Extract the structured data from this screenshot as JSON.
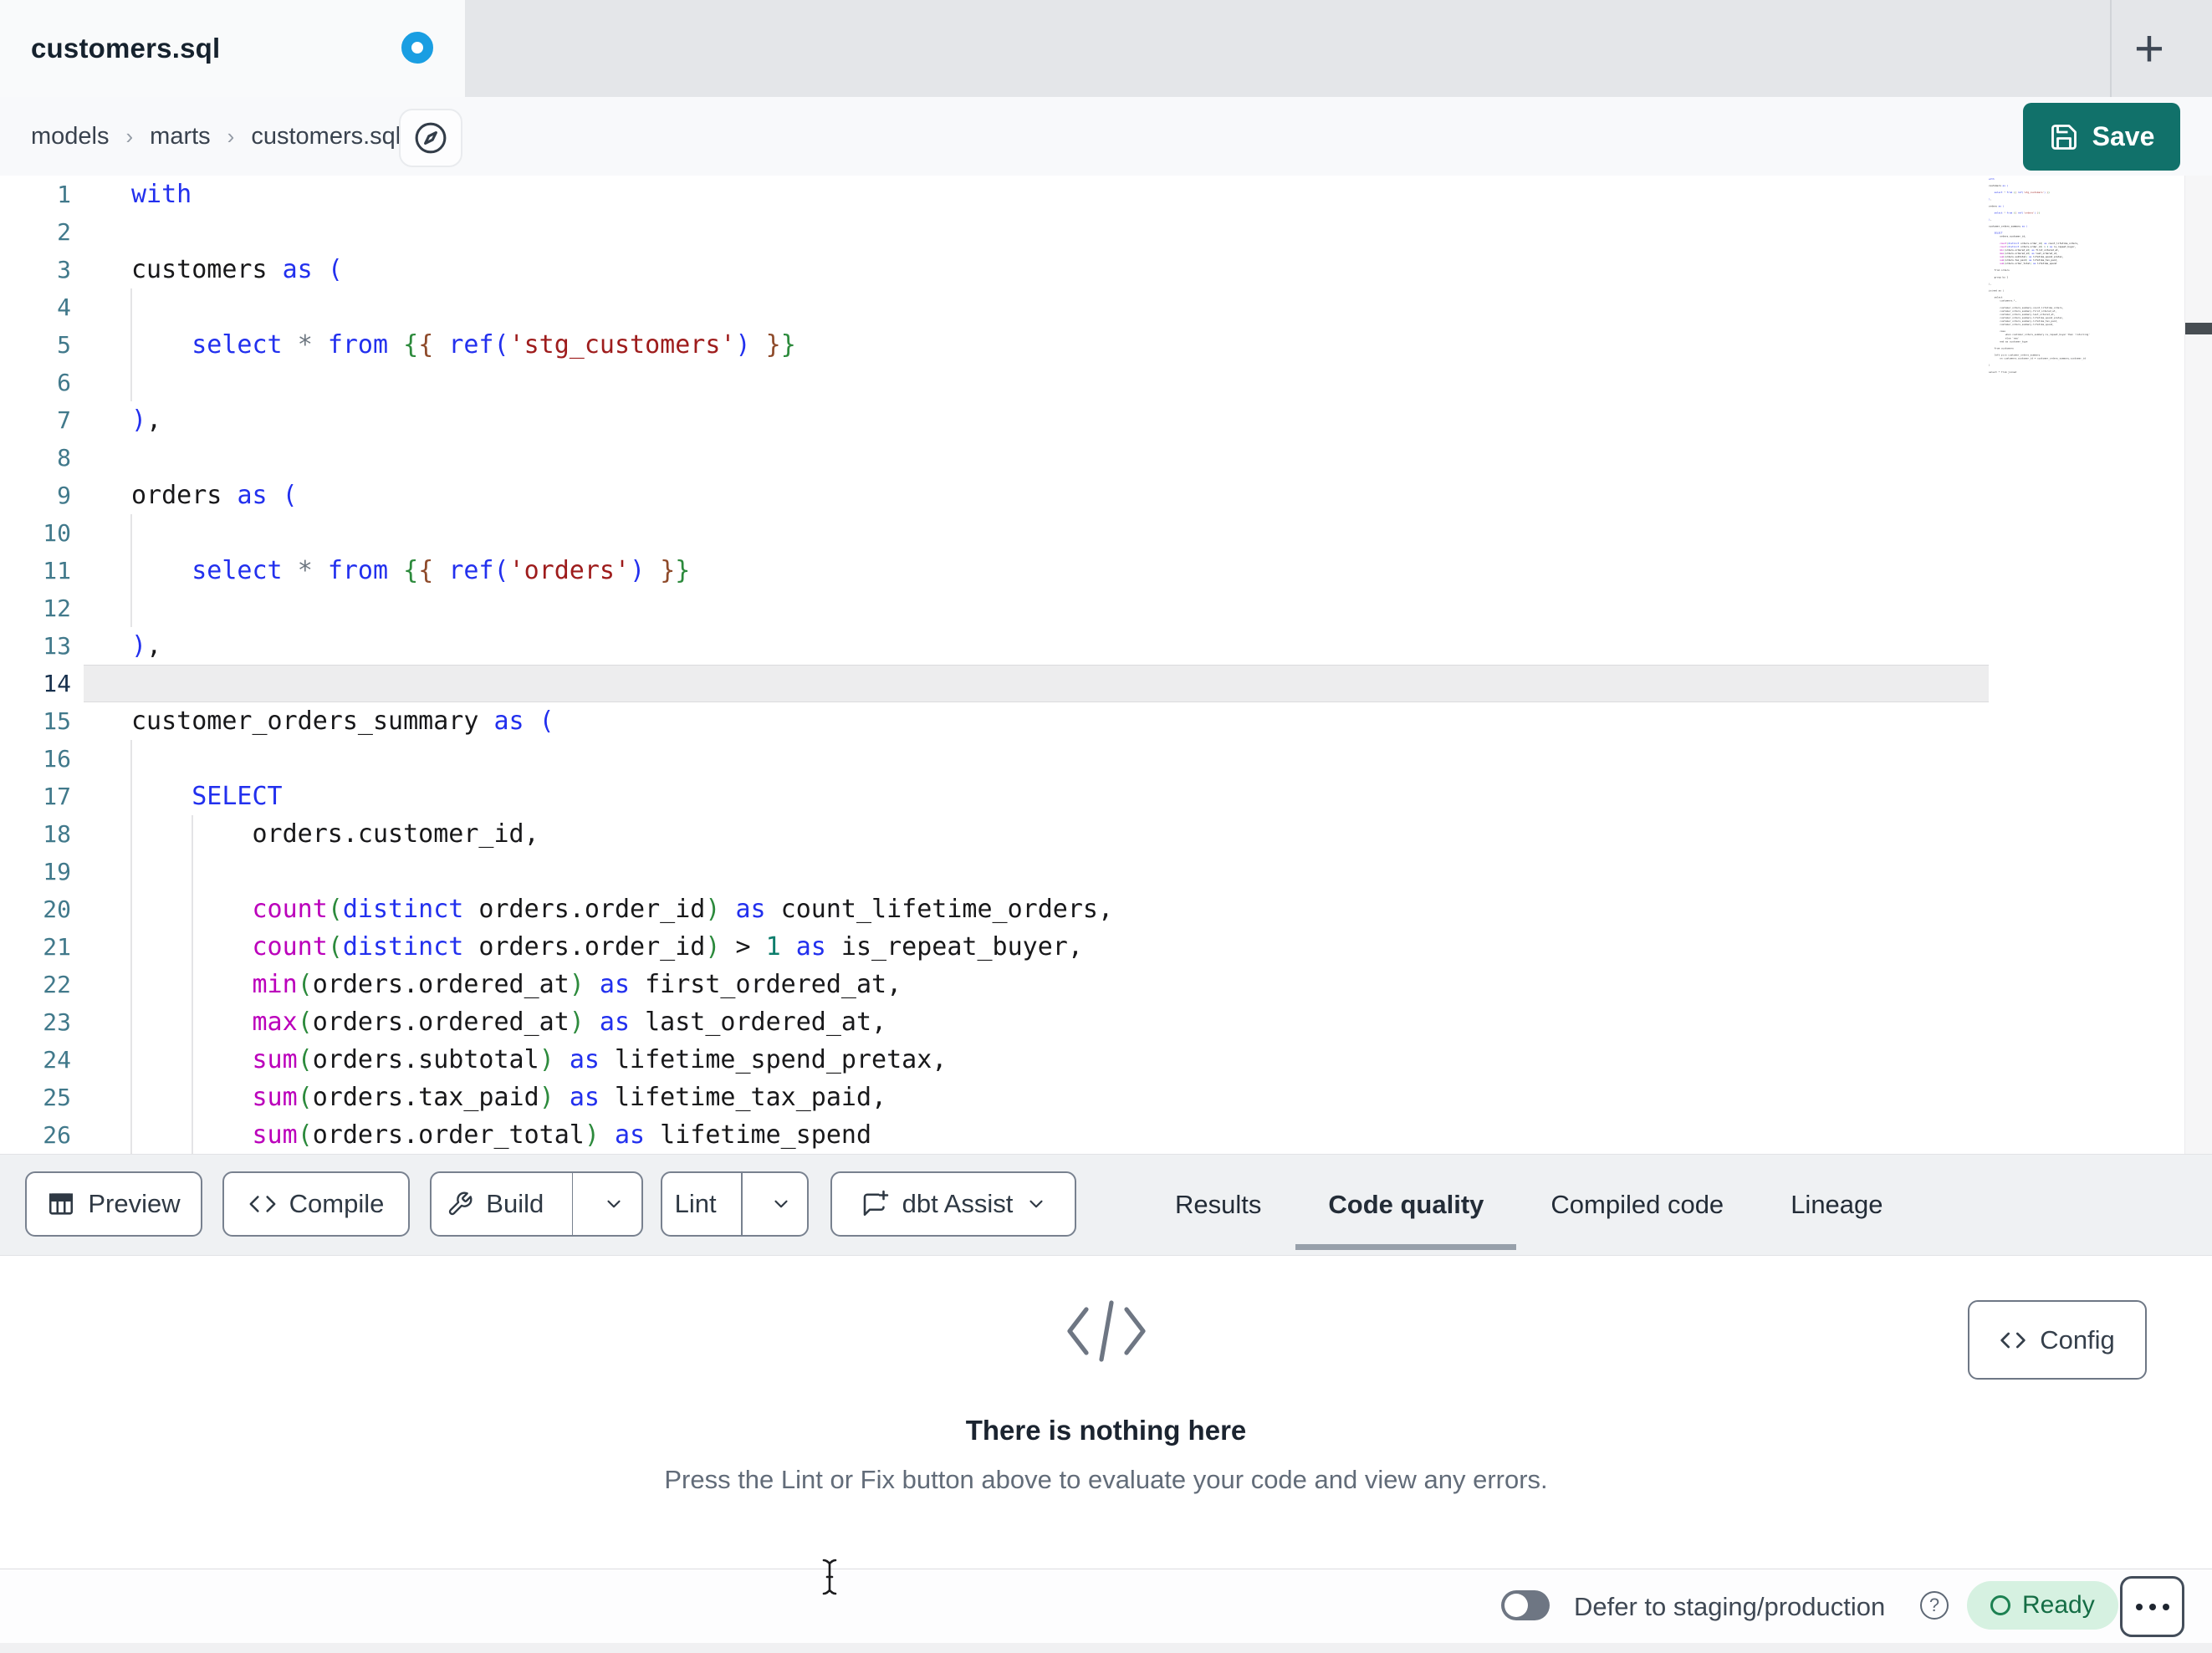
{
  "window": {
    "tab_title": "customers.sql",
    "new_tab_label": "+"
  },
  "breadcrumb": {
    "items": [
      "models",
      "marts",
      "customers.sql"
    ],
    "separator": "›"
  },
  "topbar": {
    "save_label": "Save"
  },
  "colors": {
    "save_teal": "#11716a",
    "unsaved_dot_blue": "#1a9ee2",
    "ready_green_bg": "#d6f1e1",
    "ready_green_text": "#156d45",
    "active_tab_underline": "#97a0aa",
    "keyword_blue": "#2230ee",
    "string_red": "#9e1c1c",
    "function_magenta": "#bb00bb"
  },
  "editor": {
    "active_line": 14,
    "lines": [
      {
        "n": 1,
        "tokens": [
          [
            "with",
            "kw"
          ]
        ]
      },
      {
        "n": 2,
        "tokens": []
      },
      {
        "n": 3,
        "tokens": [
          [
            "customers ",
            "tx"
          ],
          [
            "as",
            "kw"
          ],
          [
            " ",
            "tx"
          ],
          [
            "(",
            "kw"
          ]
        ]
      },
      {
        "n": 4,
        "tokens": []
      },
      {
        "n": 5,
        "tokens": [
          [
            "    ",
            "tx"
          ],
          [
            "select",
            "kw"
          ],
          [
            " ",
            "tx"
          ],
          [
            "*",
            "op"
          ],
          [
            " ",
            "tx"
          ],
          [
            "from",
            "kw"
          ],
          [
            " ",
            "tx"
          ],
          [
            "{",
            "grn"
          ],
          [
            "{",
            "brn"
          ],
          [
            " ",
            "tx"
          ],
          [
            "ref",
            "kw"
          ],
          [
            "(",
            "kw"
          ],
          [
            "'stg_customers'",
            "str"
          ],
          [
            ")",
            "kw"
          ],
          [
            " ",
            "tx"
          ],
          [
            "}",
            "brn"
          ],
          [
            "}",
            "grn"
          ]
        ]
      },
      {
        "n": 6,
        "tokens": []
      },
      {
        "n": 7,
        "tokens": [
          [
            ")",
            "kw"
          ],
          [
            ",",
            "tx"
          ]
        ]
      },
      {
        "n": 8,
        "tokens": []
      },
      {
        "n": 9,
        "tokens": [
          [
            "orders ",
            "tx"
          ],
          [
            "as",
            "kw"
          ],
          [
            " ",
            "tx"
          ],
          [
            "(",
            "kw"
          ]
        ]
      },
      {
        "n": 10,
        "tokens": []
      },
      {
        "n": 11,
        "tokens": [
          [
            "    ",
            "tx"
          ],
          [
            "select",
            "kw"
          ],
          [
            " ",
            "tx"
          ],
          [
            "*",
            "op"
          ],
          [
            " ",
            "tx"
          ],
          [
            "from",
            "kw"
          ],
          [
            " ",
            "tx"
          ],
          [
            "{",
            "grn"
          ],
          [
            "{",
            "brn"
          ],
          [
            " ",
            "tx"
          ],
          [
            "ref",
            "kw"
          ],
          [
            "(",
            "kw"
          ],
          [
            "'orders'",
            "str"
          ],
          [
            ")",
            "kw"
          ],
          [
            " ",
            "tx"
          ],
          [
            "}",
            "brn"
          ],
          [
            "}",
            "grn"
          ]
        ]
      },
      {
        "n": 12,
        "tokens": []
      },
      {
        "n": 13,
        "tokens": [
          [
            ")",
            "kw"
          ],
          [
            ",",
            "tx"
          ]
        ]
      },
      {
        "n": 14,
        "tokens": []
      },
      {
        "n": 15,
        "tokens": [
          [
            "customer_orders_summary ",
            "tx"
          ],
          [
            "as",
            "kw"
          ],
          [
            " ",
            "tx"
          ],
          [
            "(",
            "kw"
          ]
        ]
      },
      {
        "n": 16,
        "tokens": []
      },
      {
        "n": 17,
        "tokens": [
          [
            "    ",
            "tx"
          ],
          [
            "SELECT",
            "kw"
          ]
        ]
      },
      {
        "n": 18,
        "tokens": [
          [
            "        orders.customer_id,",
            "tx"
          ]
        ]
      },
      {
        "n": 19,
        "tokens": []
      },
      {
        "n": 20,
        "tokens": [
          [
            "        ",
            "tx"
          ],
          [
            "count",
            "fn"
          ],
          [
            "(",
            "grn"
          ],
          [
            "distinct",
            "kw"
          ],
          [
            " orders.order_id",
            "tx"
          ],
          [
            ")",
            "grn"
          ],
          [
            " ",
            "tx"
          ],
          [
            "as",
            "kw"
          ],
          [
            " count_lifetime_orders,",
            "tx"
          ]
        ]
      },
      {
        "n": 21,
        "tokens": [
          [
            "        ",
            "tx"
          ],
          [
            "count",
            "fn"
          ],
          [
            "(",
            "grn"
          ],
          [
            "distinct",
            "kw"
          ],
          [
            " orders.order_id",
            "tx"
          ],
          [
            ")",
            "grn"
          ],
          [
            " > ",
            "tx"
          ],
          [
            "1",
            "num"
          ],
          [
            " ",
            "tx"
          ],
          [
            "as",
            "kw"
          ],
          [
            " is_repeat_buyer,",
            "tx"
          ]
        ]
      },
      {
        "n": 22,
        "tokens": [
          [
            "        ",
            "tx"
          ],
          [
            "min",
            "fn"
          ],
          [
            "(",
            "grn"
          ],
          [
            "orders.ordered_at",
            "tx"
          ],
          [
            ")",
            "grn"
          ],
          [
            " ",
            "tx"
          ],
          [
            "as",
            "kw"
          ],
          [
            " first_ordered_at,",
            "tx"
          ]
        ]
      },
      {
        "n": 23,
        "tokens": [
          [
            "        ",
            "tx"
          ],
          [
            "max",
            "fn"
          ],
          [
            "(",
            "grn"
          ],
          [
            "orders.ordered_at",
            "tx"
          ],
          [
            ")",
            "grn"
          ],
          [
            " ",
            "tx"
          ],
          [
            "as",
            "kw"
          ],
          [
            " last_ordered_at,",
            "tx"
          ]
        ]
      },
      {
        "n": 24,
        "tokens": [
          [
            "        ",
            "tx"
          ],
          [
            "sum",
            "fn"
          ],
          [
            "(",
            "grn"
          ],
          [
            "orders.subtotal",
            "tx"
          ],
          [
            ")",
            "grn"
          ],
          [
            " ",
            "tx"
          ],
          [
            "as",
            "kw"
          ],
          [
            " lifetime_spend_pretax,",
            "tx"
          ]
        ]
      },
      {
        "n": 25,
        "tokens": [
          [
            "        ",
            "tx"
          ],
          [
            "sum",
            "fn"
          ],
          [
            "(",
            "grn"
          ],
          [
            "orders.tax_paid",
            "tx"
          ],
          [
            ")",
            "grn"
          ],
          [
            " ",
            "tx"
          ],
          [
            "as",
            "kw"
          ],
          [
            " lifetime_tax_paid,",
            "tx"
          ]
        ]
      },
      {
        "n": 26,
        "tokens": [
          [
            "        ",
            "tx"
          ],
          [
            "sum",
            "fn"
          ],
          [
            "(",
            "grn"
          ],
          [
            "orders.order_total",
            "tx"
          ],
          [
            ")",
            "grn"
          ],
          [
            " ",
            "tx"
          ],
          [
            "as",
            "kw"
          ],
          [
            " lifetime_spend",
            "tx"
          ]
        ]
      }
    ],
    "minimap_more_lines": [
      "",
      "    from orders",
      "",
      "    group by 1",
      "",
      "),",
      "",
      "joined as (",
      "",
      "    select",
      "        customers.*,",
      "",
      "        customer_orders_summary.count_lifetime_orders,",
      "        customer_orders_summary.first_ordered_at,",
      "        customer_orders_summary.last_ordered_at,",
      "        customer_orders_summary.lifetime_spend_pretax,",
      "        customer_orders_summary.lifetime_tax_paid,",
      "        customer_orders_summary.lifetime_spend,",
      "",
      "        case",
      "            when customer_orders_summary.is_repeat_buyer then 'returning'",
      "            else 'new'",
      "        end as customer_type",
      "",
      "    from customers",
      "",
      "    left join customer_orders_summary",
      "        on customers.customer_id = customer_orders_summary.customer_id",
      "",
      ")",
      "",
      "select * from joined"
    ]
  },
  "toolbar": {
    "preview_label": "Preview",
    "compile_label": "Compile",
    "build_label": "Build",
    "lint_label": "Lint",
    "assist_label": "dbt Assist"
  },
  "panel": {
    "tabs": [
      {
        "label": "Results",
        "active": false
      },
      {
        "label": "Code quality",
        "active": true
      },
      {
        "label": "Compiled code",
        "active": false
      },
      {
        "label": "Lineage",
        "active": false
      }
    ],
    "config_label": "Config",
    "empty_title": "There is nothing here",
    "empty_subtitle": "Press the Lint or Fix button above to evaluate your code and view any errors."
  },
  "statusbar": {
    "defer_label": "Defer to staging/production",
    "ready_label": "Ready",
    "defer_toggle_on": false
  }
}
